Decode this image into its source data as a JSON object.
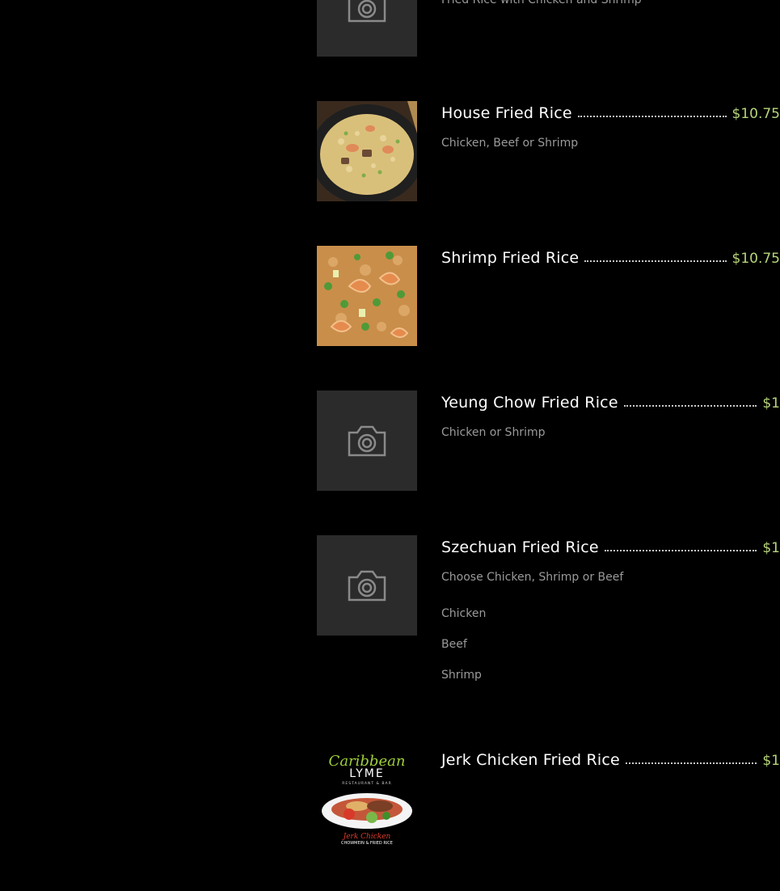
{
  "colors": {
    "background": "#000000",
    "price": "#b6d57a",
    "description": "#9a9a9a",
    "placeholder": "#2b2b2b"
  },
  "items": [
    {
      "description": "Fried Rice with Chicken and Shrimp",
      "image": "camera-placeholder-icon"
    },
    {
      "name": "House Fried Rice",
      "price": "$10.75",
      "description": "Chicken, Beef or Shrimp",
      "image": "fried-rice-wok-photo"
    },
    {
      "name": "Shrimp Fried Rice",
      "price": "$10.75",
      "image": "shrimp-fried-rice-photo"
    },
    {
      "name": "Yeung Chow Fried Rice",
      "price": "$1",
      "description": "Chicken or Shrimp",
      "image": "camera-placeholder-icon"
    },
    {
      "name": "Szechuan Fried Rice",
      "price": "$1",
      "description": "Choose Chicken, Shrimp or Beef",
      "options": [
        "Chicken",
        "Beef",
        "Shrimp"
      ],
      "image": "camera-placeholder-icon"
    },
    {
      "name": "Jerk Chicken Fried Rice",
      "price": "$1",
      "image": "caribbean-lyme-logo",
      "logo_text": [
        "Caribbean",
        "LYME",
        "RESTAURANT & BAR",
        "Jerk Chicken",
        "CHOWMEIN & FRIED RICE"
      ]
    }
  ]
}
